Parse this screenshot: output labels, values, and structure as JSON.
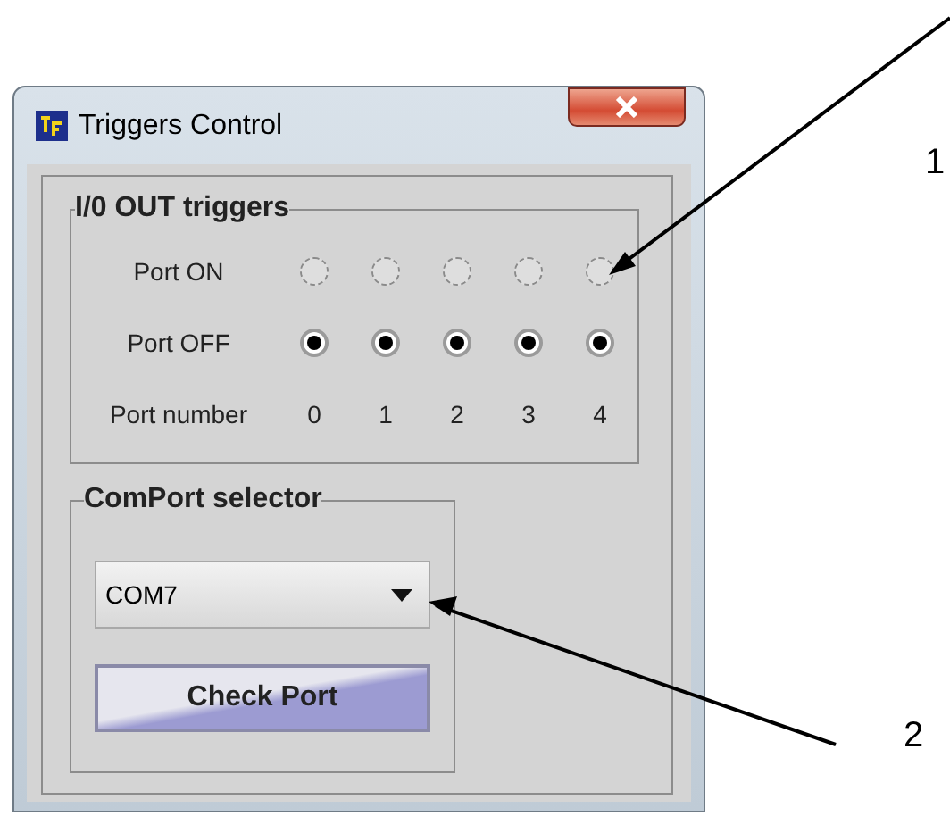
{
  "window": {
    "title": "Triggers Control"
  },
  "io_group": {
    "title": "I/0 OUT triggers",
    "rows": [
      {
        "label": "Port ON",
        "kind": "radio",
        "items": [
          {
            "selected": false
          },
          {
            "selected": false
          },
          {
            "selected": false
          },
          {
            "selected": false
          },
          {
            "selected": false
          }
        ]
      },
      {
        "label": "Port OFF",
        "kind": "radio",
        "items": [
          {
            "selected": true
          },
          {
            "selected": true
          },
          {
            "selected": true
          },
          {
            "selected": true
          },
          {
            "selected": true
          }
        ]
      },
      {
        "label": "Port number",
        "kind": "text",
        "items": [
          {
            "text": "0"
          },
          {
            "text": "1"
          },
          {
            "text": "2"
          },
          {
            "text": "3"
          },
          {
            "text": "4"
          }
        ]
      }
    ]
  },
  "comport_group": {
    "title": "ComPort selector",
    "value": "COM7",
    "button": "Check Port"
  },
  "annotations": [
    {
      "label": "1"
    },
    {
      "label": "2"
    }
  ]
}
